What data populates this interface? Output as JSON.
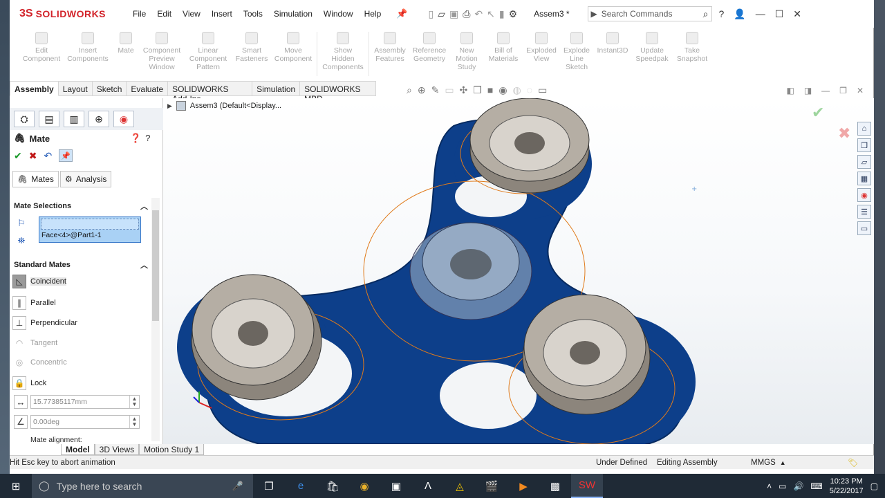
{
  "app": {
    "brand_ds": "3S",
    "brand_name": "SOLIDWORKS",
    "doc_title": "Assem3 *"
  },
  "menu": [
    "File",
    "Edit",
    "View",
    "Insert",
    "Tools",
    "Simulation",
    "Window",
    "Help"
  ],
  "search": {
    "placeholder": "Search Commands"
  },
  "command_manager": [
    {
      "label": "Edit Component"
    },
    {
      "label": "Insert Components"
    },
    {
      "label": "Mate"
    },
    {
      "label": "Component Preview Window"
    },
    {
      "label": "Linear Component Pattern"
    },
    {
      "label": "Smart Fasteners"
    },
    {
      "label": "Move Component"
    },
    {
      "label": "Show Hidden Components"
    },
    {
      "label": "Assembly Features"
    },
    {
      "label": "Reference Geometry"
    },
    {
      "label": "New Motion Study"
    },
    {
      "label": "Bill of Materials"
    },
    {
      "label": "Exploded View"
    },
    {
      "label": "Explode Line Sketch"
    },
    {
      "label": "Instant3D"
    },
    {
      "label": "Update Speedpak"
    },
    {
      "label": "Take Snapshot"
    }
  ],
  "tabs": [
    "Assembly",
    "Layout",
    "Sketch",
    "Evaluate",
    "SOLIDWORKS Add-Ins",
    "Simulation",
    "SOLIDWORKS MBD"
  ],
  "property_manager": {
    "title": "Mate",
    "subtabs": [
      "Mates",
      "Analysis"
    ],
    "mate_selections": {
      "header": "Mate Selections",
      "items": [
        "Face<4>@Part1-1"
      ]
    },
    "standard_mates": {
      "header": "Standard Mates",
      "items": [
        {
          "label": "Coincident",
          "icon": "coincident-icon",
          "selected": true,
          "enabled": true
        },
        {
          "label": "Parallel",
          "icon": "parallel-icon",
          "selected": false,
          "enabled": true
        },
        {
          "label": "Perpendicular",
          "icon": "perpendicular-icon",
          "selected": false,
          "enabled": true
        },
        {
          "label": "Tangent",
          "icon": "tangent-icon",
          "selected": false,
          "enabled": false
        },
        {
          "label": "Concentric",
          "icon": "concentric-icon",
          "selected": false,
          "enabled": false
        },
        {
          "label": "Lock",
          "icon": "lock-icon",
          "selected": false,
          "enabled": true
        }
      ]
    },
    "distance_value": "15.77385117mm",
    "angle_value": "0.00deg",
    "alignment_label": "Mate alignment:"
  },
  "feature_tree": {
    "root": "Assem3  (Default<Display..."
  },
  "bottom_tabs": [
    "Model",
    "3D Views",
    "Motion Study 1"
  ],
  "status": {
    "message": "Hit Esc key to abort animation",
    "state": "Under Defined",
    "mode": "Editing Assembly",
    "units": "MMGS"
  },
  "taskbar": {
    "search_placeholder": "Type here to search",
    "time": "10:23 PM",
    "date": "5/22/2017"
  },
  "colors": {
    "brand": "#d2232a",
    "part_blue": "#0d3f8a",
    "selection": "#a9d1f5",
    "edge_orange": "#e07a1a"
  }
}
